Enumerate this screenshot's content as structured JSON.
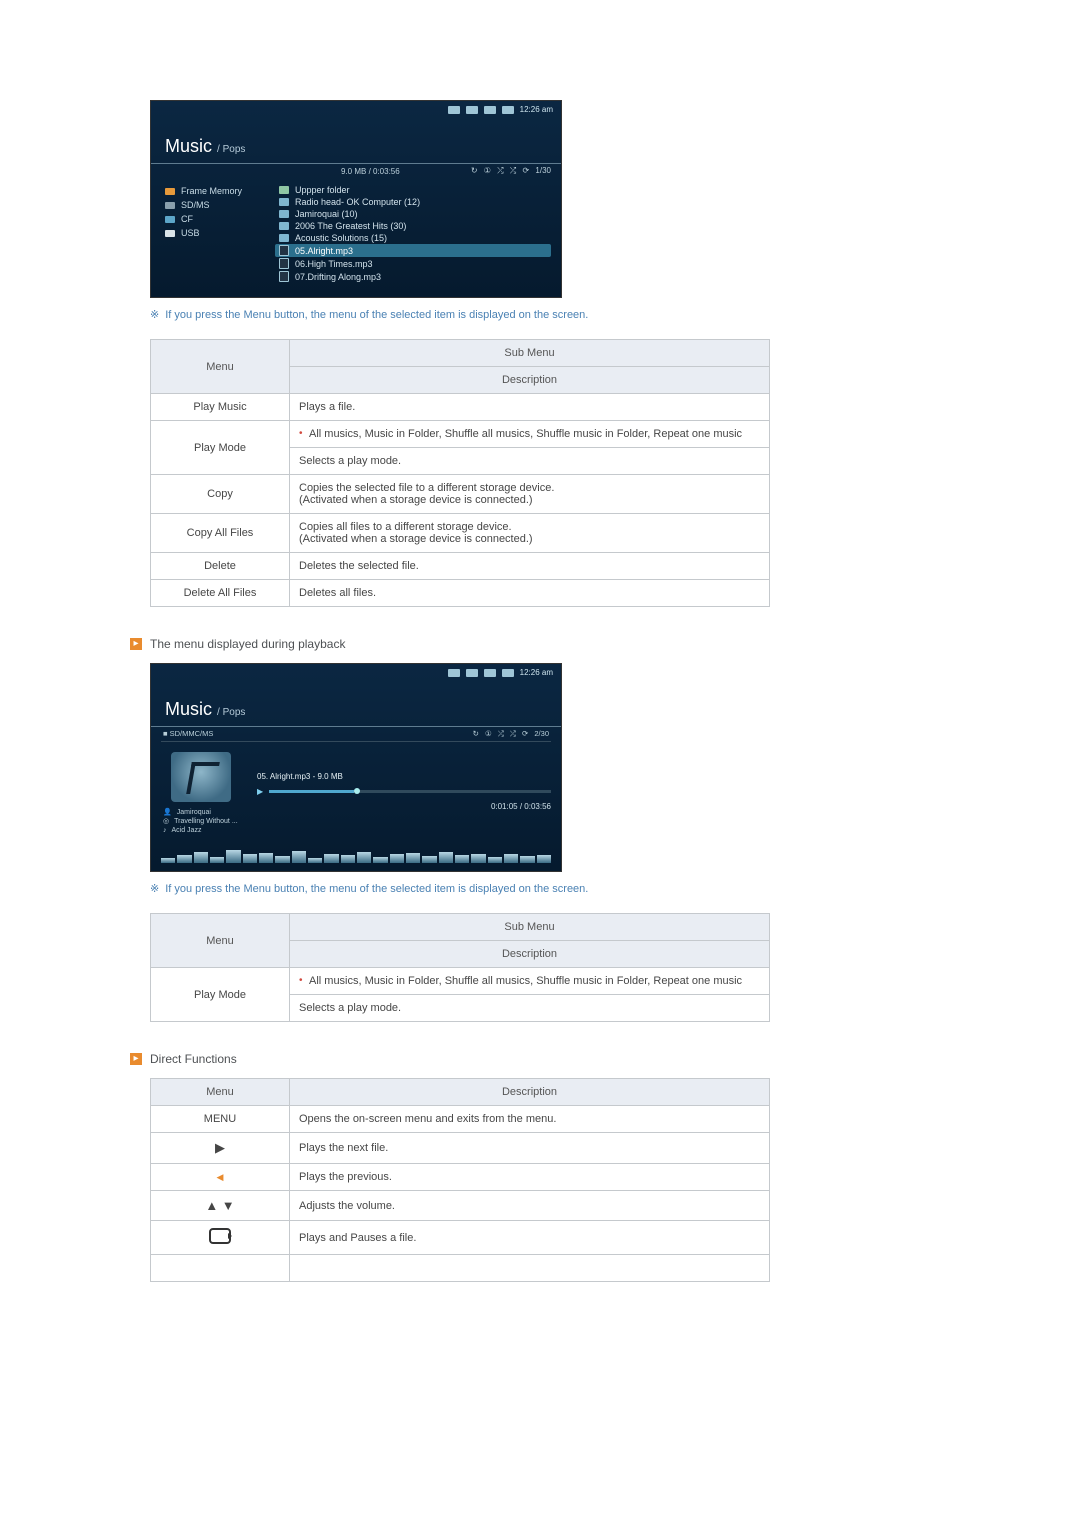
{
  "screenshot1": {
    "status_time": "12:26 am",
    "title_main": "Music",
    "title_sub": "/ Pops",
    "filesize_time": "9.0 MB / 0:03:56",
    "counter": "1/30",
    "nav": [
      {
        "label": "Frame Memory"
      },
      {
        "label": "SD/MS"
      },
      {
        "label": "CF"
      },
      {
        "label": "USB"
      }
    ],
    "list": [
      {
        "type": "up",
        "label": "Uppper folder"
      },
      {
        "type": "fld",
        "label": "Radio head- OK Computer (12)"
      },
      {
        "type": "fld",
        "label": "Jamiroquai (10)"
      },
      {
        "type": "fld",
        "label": "2006 The Greatest Hits (30)"
      },
      {
        "type": "fld",
        "label": "Acoustic Solutions (15)"
      },
      {
        "type": "sel",
        "label": "05.Alright.mp3"
      },
      {
        "type": "note",
        "label": "06.High Times.mp3"
      },
      {
        "type": "note",
        "label": "07.Drifting Along.mp3"
      }
    ]
  },
  "note1": "If you press the Menu button, the menu of the selected item is displayed on the screen.",
  "table1": {
    "head_menu": "Menu",
    "head_sub": "Sub Menu",
    "head_desc": "Description",
    "rows": [
      {
        "menu": "Play Music",
        "sub": "",
        "desc": "Plays a file."
      },
      {
        "menu": "Play Mode",
        "sub": "All musics, Music in Folder, Shuffle all musics, Shuffle music in Folder, Repeat one music",
        "desc": "Selects a play mode."
      },
      {
        "menu": "Copy",
        "sub": "",
        "desc": "Copies the selected file to a different storage device.\n(Activated when a storage device is connected.)"
      },
      {
        "menu": "Copy All Files",
        "sub": "",
        "desc": "Copies all files to a different storage device.\n(Activated when a storage device is connected.)"
      },
      {
        "menu": "Delete",
        "sub": "",
        "desc": "Deletes the selected file."
      },
      {
        "menu": "Delete All Files",
        "sub": "",
        "desc": "Deletes all files."
      }
    ]
  },
  "section_playback": "The menu displayed during playback",
  "screenshot2": {
    "status_time": "12:26 am",
    "title_main": "Music",
    "title_sub": "/ Pops",
    "source": "SD/MMC/MS",
    "counter": "2/30",
    "track_title": "05. Alright.mp3 - 9.0 MB",
    "elapsed_total": "0:01:05 / 0:03:56",
    "meta_artist": "Jamiroquai",
    "meta_album": "Travelling Without ...",
    "meta_genre": "Acid Jazz"
  },
  "note2": "If you press the Menu button, the menu of the selected item is displayed on the screen.",
  "table2": {
    "head_menu": "Menu",
    "head_sub": "Sub Menu",
    "head_desc": "Description",
    "rows": [
      {
        "menu": "Play Mode",
        "sub": "All musics, Music in Folder, Shuffle all musics, Shuffle music in Folder, Repeat one music",
        "desc": "Selects a play mode."
      }
    ]
  },
  "section_direct": "Direct Functions",
  "table3": {
    "head_menu": "Menu",
    "head_desc": "Description",
    "rows": [
      {
        "menu_text": "MENU",
        "desc": "Opens the on-screen menu and exits from the menu."
      },
      {
        "menu_sym": "▶",
        "desc": "Plays the next file."
      },
      {
        "menu_sym": "◀",
        "sym_color": "#e98b2e",
        "sym_小": true,
        "desc": "Plays the previous."
      },
      {
        "menu_sym": "▲ ▼",
        "desc": "Adjusts the volume."
      },
      {
        "menu_loop": true,
        "desc": "Plays and Pauses a file."
      }
    ]
  }
}
